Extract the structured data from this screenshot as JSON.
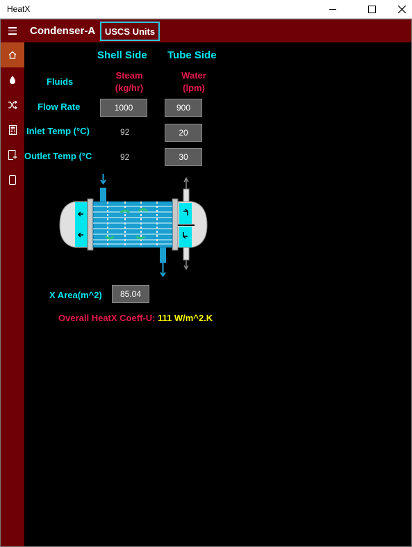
{
  "window": {
    "title": "HeatX"
  },
  "header": {
    "title": "Condenser-A",
    "units_button": "USCS Units"
  },
  "nav": {
    "items": [
      "home-icon",
      "drop-icon",
      "shuffle-icon",
      "calculator-icon",
      "note-icon",
      "tablet-icon"
    ],
    "active": "home-icon"
  },
  "columns": {
    "shell": "Shell Side",
    "tube": "Tube Side"
  },
  "labels": {
    "fluids": "Fluids",
    "flow_rate": "Flow Rate",
    "inlet_temp": "Inlet Temp (°C)",
    "outlet_temp": "Outlet Temp (°C",
    "x_area": "X Area(m^2)"
  },
  "shell": {
    "fluid": "Steam",
    "unit": "(kg/hr)",
    "flow_rate": "1000",
    "inlet_temp": "92",
    "outlet_temp": "92"
  },
  "tube": {
    "fluid": "Water",
    "unit": "(lpm)",
    "flow_rate": "900",
    "inlet_temp": "20",
    "outlet_temp": "30"
  },
  "area": {
    "value": "85.04"
  },
  "result": {
    "label": "Overall HeatX Coeff-U: ",
    "value": "111 W/m^2.K"
  },
  "colors": {
    "brand": "#6e0006",
    "accent": "#00e6ee",
    "unit_red": "#e6194b",
    "result_yellow": "#ffff00"
  }
}
